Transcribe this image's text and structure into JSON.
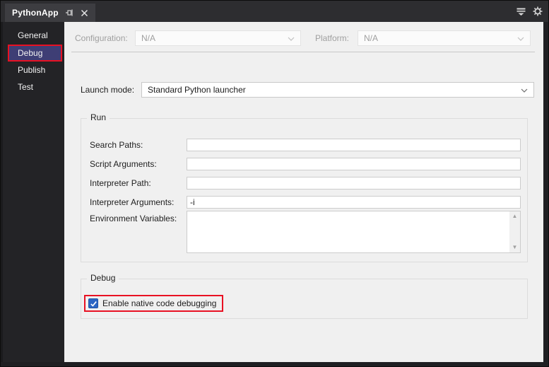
{
  "tab": {
    "title": "PythonApp"
  },
  "tab_icons": {
    "pin": "pin-icon",
    "close": "close-icon"
  },
  "toolbar_icons": {
    "filter": "filter-icon",
    "gear": "gear-icon"
  },
  "sidebar": {
    "items": [
      {
        "label": "General",
        "selected": false
      },
      {
        "label": "Debug",
        "selected": true,
        "annotated": true
      },
      {
        "label": "Publish",
        "selected": false
      },
      {
        "label": "Test",
        "selected": false
      }
    ]
  },
  "header": {
    "configuration": {
      "label": "Configuration:",
      "value": "N/A",
      "disabled": true
    },
    "platform": {
      "label": "Platform:",
      "value": "N/A",
      "disabled": true
    }
  },
  "launch_mode": {
    "label": "Launch mode:",
    "value": "Standard Python launcher"
  },
  "run_group": {
    "title": "Run",
    "fields": [
      {
        "label": "Search Paths:",
        "value": ""
      },
      {
        "label": "Script Arguments:",
        "value": ""
      },
      {
        "label": "Interpreter Path:",
        "value": ""
      },
      {
        "label": "Interpreter Arguments:",
        "value": "-i"
      },
      {
        "label": "Environment Variables:",
        "value": "",
        "multiline": true
      }
    ]
  },
  "debug_group": {
    "title": "Debug",
    "checkbox": {
      "label": "Enable native code debugging",
      "checked": true,
      "annotated": true
    }
  },
  "glyphs": {
    "scroll_up": "▲",
    "scroll_down": "▼"
  },
  "colors": {
    "annotation_red": "#e81123",
    "sidebar_selection": "#3e3e75",
    "checkbox_blue": "#2a65c4",
    "shell_dark": "#2d2d30",
    "panel_light": "#f0f0f0"
  }
}
